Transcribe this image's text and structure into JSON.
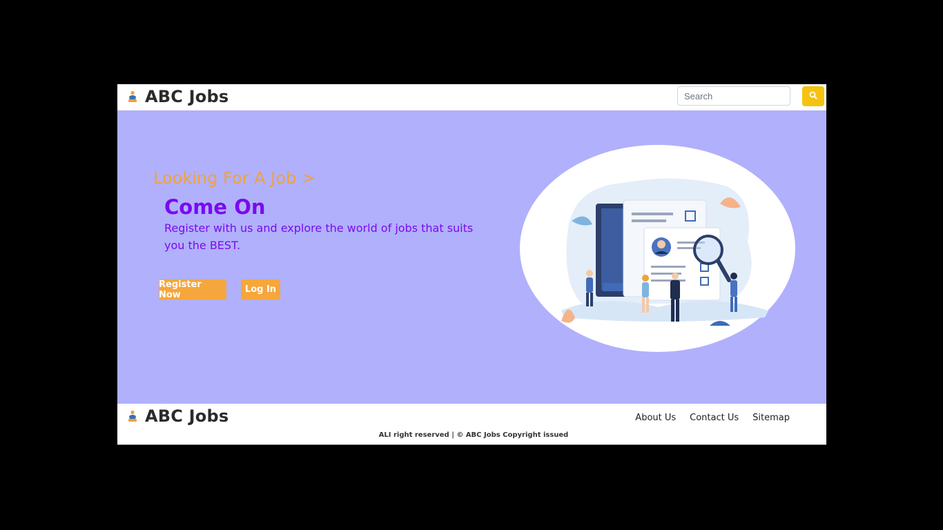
{
  "header": {
    "brand": "ABC Jobs",
    "search_placeholder": "Search",
    "search_icon": "search-icon"
  },
  "hero": {
    "heading": "Looking For A Job >",
    "title": "Come On",
    "text": "Register with us and explore the world of jobs that suits you the BEST.",
    "register_label": "Register Now",
    "login_label": "Log In",
    "illustration": "recruitment-illustration"
  },
  "footer": {
    "brand": "ABC Jobs",
    "links": [
      "About Us",
      "Contact Us",
      "Sitemap"
    ],
    "copyright": "ALI right reserved | © ABC Jobs Copyright issued"
  },
  "colors": {
    "hero_bg": "#b1b0fc",
    "accent_orange": "#f5a63c",
    "heading_orange": "#f0a23c",
    "title_purple": "#7a0af0",
    "search_yellow": "#f5c211"
  }
}
